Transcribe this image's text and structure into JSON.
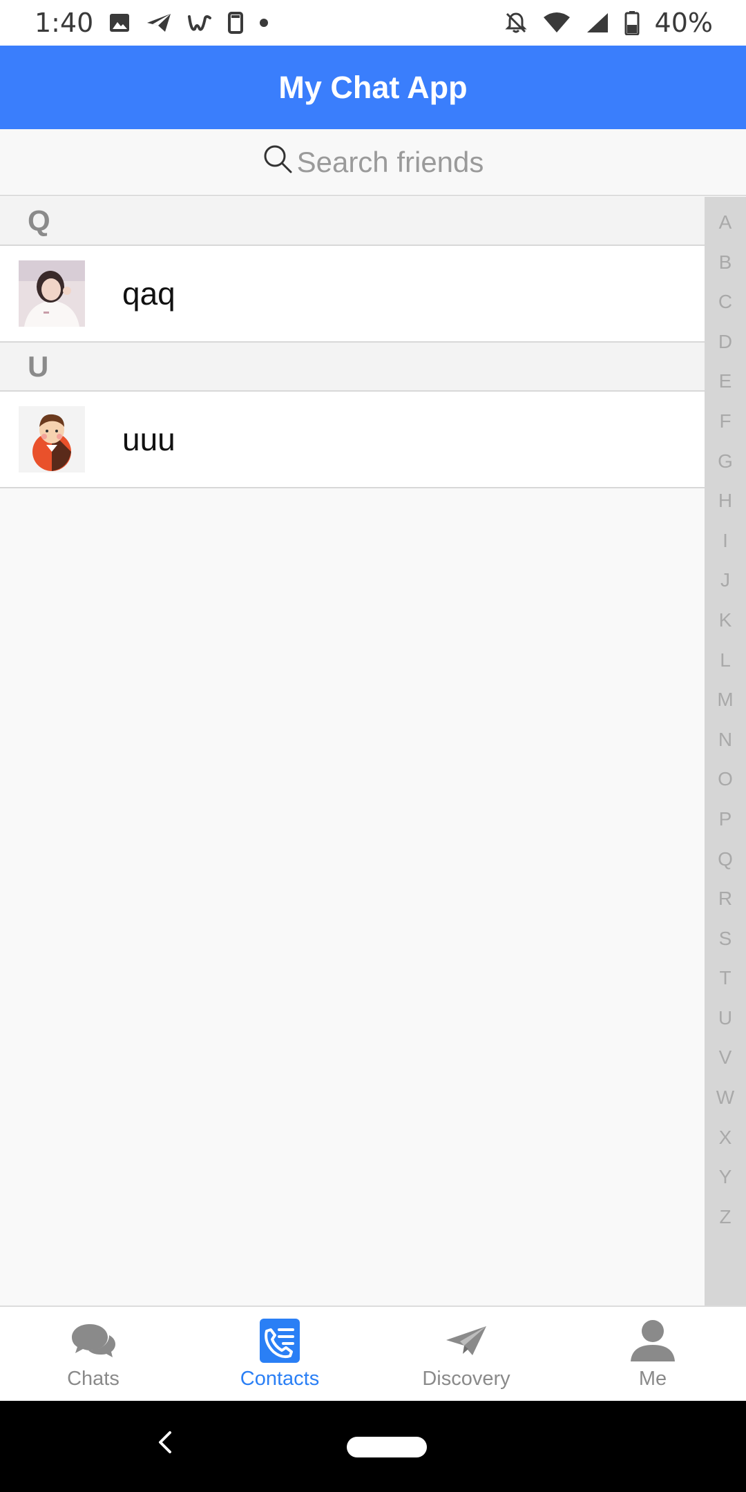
{
  "status_bar": {
    "time": "1:40",
    "notification_icons": [
      "image-icon",
      "send-icon",
      "w-app-icon",
      "phone-outline-icon",
      "dot-icon"
    ],
    "system_icons": [
      "bell-off-icon",
      "wifi-icon",
      "signal-icon",
      "battery-icon"
    ],
    "battery": "40%"
  },
  "app_bar": {
    "title": "My Chat App",
    "color": "#3a7efc"
  },
  "search": {
    "icon": "search-icon",
    "placeholder": "Search friends"
  },
  "sections": [
    {
      "letter": "Q",
      "contacts": [
        {
          "name": "qaq",
          "avatar": "photo-avatar"
        }
      ]
    },
    {
      "letter": "U",
      "contacts": [
        {
          "name": "uuu",
          "avatar": "cartoon-avatar"
        }
      ]
    }
  ],
  "index_letters": [
    "A",
    "B",
    "C",
    "D",
    "E",
    "F",
    "G",
    "H",
    "I",
    "J",
    "K",
    "L",
    "M",
    "N",
    "O",
    "P",
    "Q",
    "R",
    "S",
    "T",
    "U",
    "V",
    "W",
    "X",
    "Y",
    "Z"
  ],
  "tabs": [
    {
      "label": "Chats",
      "icon": "chat-bubbles-icon",
      "active": false
    },
    {
      "label": "Contacts",
      "icon": "contacts-book-icon",
      "active": true
    },
    {
      "label": "Discovery",
      "icon": "paper-plane-icon",
      "active": false
    },
    {
      "label": "Me",
      "icon": "person-icon",
      "active": false
    }
  ],
  "colors": {
    "accent": "#2a7ff5",
    "inactive": "#8a8a8a"
  }
}
